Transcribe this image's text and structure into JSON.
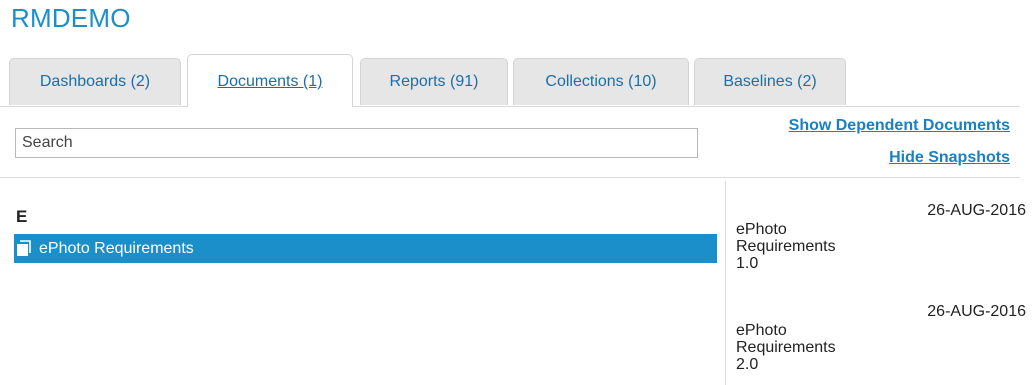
{
  "app": {
    "title": "RMDEMO"
  },
  "tabs": [
    {
      "label": "Dashboards (2)"
    },
    {
      "label": "Documents (1)"
    },
    {
      "label": "Reports (91)"
    },
    {
      "label": "Collections (10)"
    },
    {
      "label": "Baselines (2)"
    }
  ],
  "active_tab": "Documents (1)",
  "search": {
    "placeholder": "Search",
    "value": ""
  },
  "links": {
    "show_dependent": "Show Dependent Documents",
    "hide_snapshots": "Hide Snapshots"
  },
  "documents": {
    "group_letter": "E",
    "items": [
      {
        "name": "ePhoto Requirements",
        "selected": true,
        "icon": "document-icon"
      }
    ]
  },
  "snapshots": [
    {
      "date": "26-AUG-2016",
      "line1": "ePhoto",
      "line2": "Requirements",
      "line3": "1.0"
    },
    {
      "date": "26-AUG-2016",
      "line1": "ePhoto",
      "line2": "Requirements",
      "line3": "2.0"
    }
  ],
  "colors": {
    "accent": "#1b8fc9",
    "link": "#1b7fc0",
    "tab_bg": "#e6e6e6"
  }
}
